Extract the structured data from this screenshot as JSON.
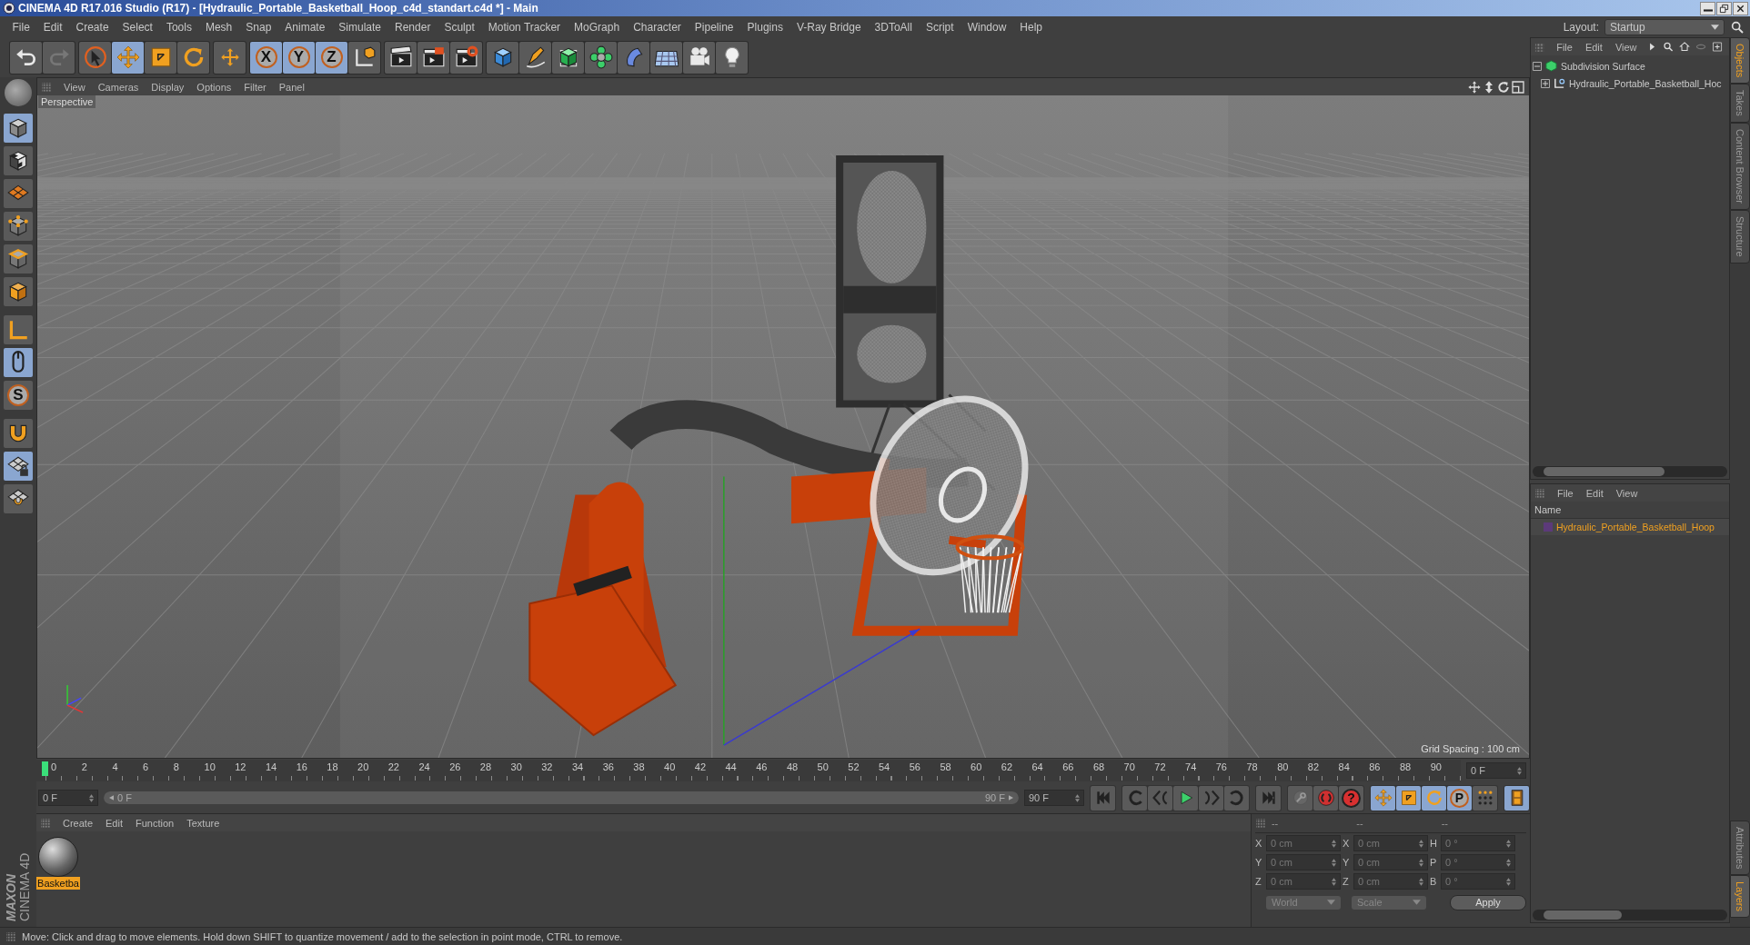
{
  "window": {
    "title": "CINEMA 4D R17.016 Studio (R17) - [Hydraulic_Portable_Basketball_Hoop_c4d_standart.c4d *] - Main"
  },
  "menu": [
    "File",
    "Edit",
    "Create",
    "Select",
    "Tools",
    "Mesh",
    "Snap",
    "Animate",
    "Simulate",
    "Render",
    "Sculpt",
    "Motion Tracker",
    "MoGraph",
    "Character",
    "Pipeline",
    "Plugins",
    "V-Ray Bridge",
    "3DToAll",
    "Script",
    "Window",
    "Help"
  ],
  "layout": {
    "label": "Layout:",
    "value": "Startup"
  },
  "toolbar": [
    {
      "items": [
        {
          "kind": "undo",
          "selected": false
        },
        {
          "kind": "redo",
          "selected": false
        }
      ]
    },
    {
      "items": [
        {
          "kind": "select",
          "selected": false
        },
        {
          "kind": "move",
          "selected": true
        },
        {
          "kind": "scale",
          "selected": false
        },
        {
          "kind": "rotate",
          "selected": false
        }
      ]
    },
    {
      "items": [
        {
          "kind": "add",
          "selected": false
        }
      ]
    },
    {
      "items": [
        {
          "kind": "axis",
          "label": "X",
          "selected": true
        },
        {
          "kind": "axis",
          "label": "Y",
          "selected": true
        },
        {
          "kind": "axis",
          "label": "Z",
          "selected": true
        },
        {
          "kind": "coords",
          "selected": false
        }
      ]
    },
    {
      "items": [
        {
          "kind": "render-view",
          "selected": false
        },
        {
          "kind": "render-picture",
          "selected": false
        },
        {
          "kind": "render-settings",
          "selected": false
        }
      ]
    },
    {
      "items": [
        {
          "kind": "cube",
          "selected": false
        },
        {
          "kind": "pen",
          "selected": false
        },
        {
          "kind": "subdiv",
          "selected": false
        },
        {
          "kind": "cloner",
          "selected": false
        },
        {
          "kind": "deformer",
          "selected": false
        },
        {
          "kind": "floor",
          "selected": false
        },
        {
          "kind": "camera",
          "selected": false
        },
        {
          "kind": "light",
          "selected": false
        }
      ]
    }
  ],
  "tools": [
    {
      "kind": "model",
      "selected": true
    },
    {
      "kind": "texture",
      "selected": false
    },
    {
      "kind": "workplane",
      "selected": false
    },
    {
      "kind": "points",
      "selected": false
    },
    {
      "kind": "edges",
      "selected": false
    },
    {
      "kind": "polygons",
      "selected": false
    },
    {
      "kind": "axis-mode",
      "selected": false
    },
    {
      "kind": "tweak",
      "selected": true
    },
    {
      "kind": "solo",
      "label": "S",
      "selected": false
    },
    {
      "kind": "magnet",
      "selected": false
    },
    {
      "kind": "lock-grid",
      "selected": true
    },
    {
      "kind": "snap-grid",
      "selected": false
    }
  ],
  "branding": [
    "MAXON",
    "CINEMA 4D"
  ],
  "viewport": {
    "menu": [
      "View",
      "Cameras",
      "Display",
      "Options",
      "Filter",
      "Panel"
    ],
    "camera": "Perspective",
    "grid_spacing": "Grid Spacing : 100 cm"
  },
  "timeline": {
    "ticks": [
      "0",
      "2",
      "4",
      "6",
      "8",
      "10",
      "12",
      "14",
      "16",
      "18",
      "20",
      "22",
      "24",
      "26",
      "28",
      "30",
      "32",
      "34",
      "36",
      "38",
      "40",
      "42",
      "44",
      "46",
      "48",
      "50",
      "52",
      "54",
      "56",
      "58",
      "60",
      "62",
      "64",
      "66",
      "68",
      "70",
      "72",
      "74",
      "76",
      "78",
      "80",
      "82",
      "84",
      "86",
      "88",
      "90"
    ],
    "playhead": {
      "level": 0
    },
    "current_frame": "0 F",
    "start_field": "0 F",
    "range": {
      "start": "0 F",
      "end": "90 F",
      "level": 1
    },
    "end_field": "90 F",
    "transport": [
      {
        "items": [
          {
            "kind": "first",
            "selected": false
          }
        ]
      },
      {
        "items": [
          {
            "kind": "prev-key",
            "selected": false
          },
          {
            "kind": "prev-frame",
            "selected": false
          },
          {
            "kind": "play",
            "selected": false
          },
          {
            "kind": "next-frame",
            "selected": false
          },
          {
            "kind": "next-key",
            "selected": false
          }
        ]
      },
      {
        "items": [
          {
            "kind": "last",
            "selected": false
          }
        ]
      },
      {
        "items": [
          {
            "kind": "key-off",
            "selected": false
          },
          {
            "kind": "autokey",
            "selected": false
          },
          {
            "kind": "help",
            "label": "?",
            "selected": false
          }
        ]
      },
      {
        "items": [
          {
            "kind": "move",
            "selected": true
          },
          {
            "kind": "scale",
            "selected": true
          },
          {
            "kind": "rotate",
            "selected": true
          },
          {
            "kind": "point",
            "label": "P",
            "selected": true
          },
          {
            "kind": "dots",
            "selected": false
          }
        ]
      },
      {
        "items": [
          {
            "kind": "film",
            "selected": true
          }
        ]
      }
    ]
  },
  "materials": {
    "menu": [
      "Create",
      "Edit",
      "Function",
      "Texture"
    ],
    "items": [
      {
        "name": "Basketba",
        "selected": true
      }
    ]
  },
  "coordinates": {
    "headers": [
      "--",
      "--",
      "--"
    ],
    "rows": [
      {
        "axis": "X",
        "position": "0 cm",
        "size_axis": "X",
        "size": "0 cm",
        "rot_axis": "H",
        "rotation": "0 °"
      },
      {
        "axis": "Y",
        "position": "0 cm",
        "size_axis": "Y",
        "size": "0 cm",
        "rot_axis": "P",
        "rotation": "0 °"
      },
      {
        "axis": "Z",
        "position": "0 cm",
        "size_axis": "Z",
        "size": "0 cm",
        "rot_axis": "B",
        "rotation": "0 °"
      }
    ],
    "mode": "World",
    "size_mode": "Scale",
    "apply": "Apply"
  },
  "objects": {
    "menu": [
      "File",
      "Edit",
      "View"
    ],
    "tree": [
      {
        "name": "Subdivision Surface",
        "kind": "subdivision",
        "expanded": true,
        "children": [
          {
            "name": "Hydraulic_Portable_Basketball_Hoc",
            "kind": "null",
            "expanded": false
          }
        ]
      }
    ]
  },
  "layers": {
    "menu": [
      "File",
      "Edit",
      "View"
    ],
    "column": "Name",
    "rows": [
      {
        "name": "Hydraulic_Portable_Basketball_Hoop",
        "color": "#5c3a7a"
      }
    ]
  },
  "side_tabs": [
    {
      "label": "Objects",
      "selected": true
    },
    {
      "label": "Takes",
      "selected": false
    },
    {
      "label": "Content Browser",
      "selected": false
    },
    {
      "label": "Structure",
      "selected": false
    }
  ],
  "side_tabs_lower": [
    {
      "label": "Attributes",
      "selected": false
    },
    {
      "label": "Layers",
      "selected": true
    }
  ],
  "status_bar": "Move: Click and drag to move elements. Hold down SHIFT to quantize movement / add to the selection in point mode, CTRL to remove."
}
